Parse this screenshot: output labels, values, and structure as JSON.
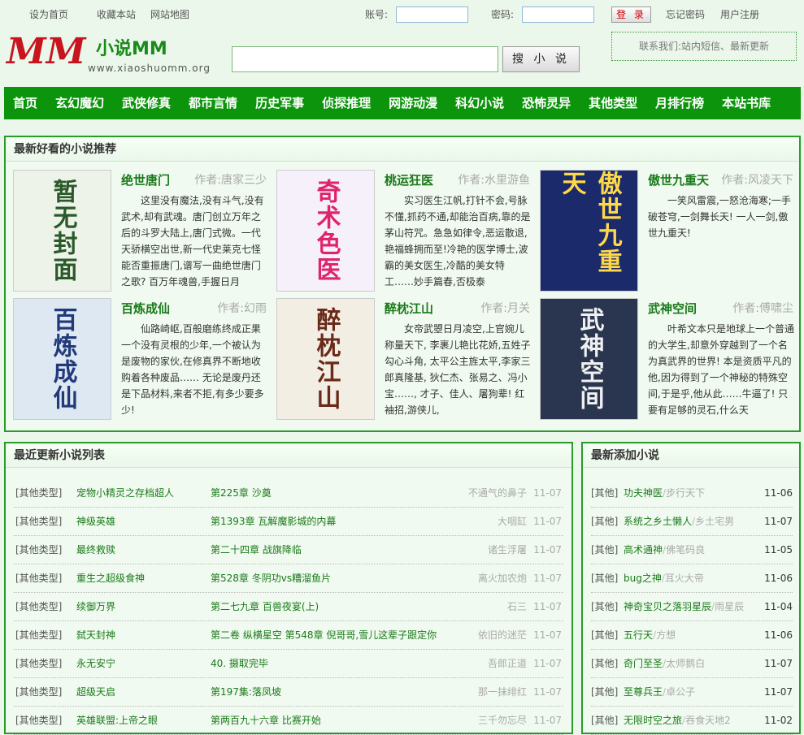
{
  "top_links": {
    "home": "设为首页",
    "fav": "收藏本站",
    "map": "网站地图"
  },
  "login": {
    "account_label": "账号:",
    "password_label": "密码:",
    "button": "登 录",
    "forgot": "忘记密码",
    "register": "用户注册"
  },
  "logo": {
    "mm": "MM",
    "cn": "小说MM",
    "url": "www.xiaoshuomm.org"
  },
  "search": {
    "button": "搜 小 说"
  },
  "contact": "联系我们:站内短信、最新更新",
  "nav": [
    "首页",
    "玄幻魔幻",
    "武侠修真",
    "都市言情",
    "历史军事",
    "侦探推理",
    "网游动漫",
    "科幻小说",
    "恐怖灵异",
    "其他类型",
    "月排行榜",
    "本站书库"
  ],
  "recommend": {
    "title": "最新好看的小说推荐",
    "books": [
      {
        "title": "绝世唐门",
        "author": "作者:唐家三少",
        "cover_text": "暂无封面",
        "desc": "这里没有魔法,没有斗气,没有武术,却有武魂。唐门创立万年之后的斗罗大陆上,唐门式微。一代天骄横空出世,新一代史莱克七怪能否重振唐门,谱写一曲绝世唐门之歌? 百万年魂兽,手握日月"
      },
      {
        "title": "桃运狂医",
        "author": "作者:水里游鱼",
        "cover_text": "奇术色医",
        "desc": "实习医生江帆,打针不会,号脉不懂,抓药不通,却能治百病,靠的是茅山符咒。急急如律令,恶运散退,艳福蜂拥而至!冷艳的医学博士,波霸的美女医生,冷酷的美女特工……妙手篇春,否极泰"
      },
      {
        "title": "傲世九重天",
        "author": "作者:风凌天下",
        "cover_text": "傲世九重天",
        "desc": "一笑风雷震,一怒沧海寒;一手破苍穹,一剑舞长天! 一人一剑,傲世九重天!"
      },
      {
        "title": "百炼成仙",
        "author": "作者:幻雨",
        "cover_text": "百炼成仙",
        "desc": "仙路崎岖,百般磨练终成正果一个没有灵根的少年,一个被认为是废物的家伙,在修真界不断地收购着各种废品…… 无论是废丹还是下品材料,来者不拒,有多少要多少!"
      },
      {
        "title": "醉枕江山",
        "author": "作者:月关",
        "cover_text": "醉枕江山",
        "desc": "女帝武曌日月凌空,上官婉儿称量天下, 李裹儿艳比花娇,五姓子勾心斗角, 太平公主旌太平,李家三郎真隆基, 狄仁杰、张易之、冯小宝……, 才子、佳人、屠狗辈! 红袖招,游侠儿,"
      },
      {
        "title": "武神空间",
        "author": "作者:傅啸尘",
        "cover_text": "武神空间",
        "desc": "叶希文本只是地球上一个普通的大学生,却意外穿越到了一个名为真武界的世界! 本是资质平凡的他,因为得到了一个神秘的特殊空间,于是乎,他从此……牛逼了! 只要有足够的灵石,什么天"
      }
    ]
  },
  "updates": {
    "title": "最近更新小说列表",
    "rows": [
      {
        "cat": "[其他类型]",
        "name": "宠物小精灵之存档超人",
        "chapter": "第225章 沙奠",
        "author": "不通气的鼻子",
        "date": "11-07"
      },
      {
        "cat": "[其他类型]",
        "name": "神级英雄",
        "chapter": "第1393章 瓦解魔影城的内幕",
        "author": "大咽缸",
        "date": "11-07"
      },
      {
        "cat": "[其他类型]",
        "name": "最终救赎",
        "chapter": "第二十四章 战旗降临",
        "author": "诸生浮屠",
        "date": "11-07"
      },
      {
        "cat": "[其他类型]",
        "name": "重生之超级食神",
        "chapter": "第528章 冬阴功vs糟溜鱼片",
        "author": "离火加农炮",
        "date": "11-07"
      },
      {
        "cat": "[其他类型]",
        "name": "续御万界",
        "chapter": "第二七九章 百兽夜宴(上)",
        "author": "石三",
        "date": "11-07"
      },
      {
        "cat": "[其他类型]",
        "name": "弑天封神",
        "chapter": "第二卷 纵横星空 第548章 倪哥哥,雪儿这辈子跟定你",
        "author": "依旧的迷茫",
        "date": "11-07"
      },
      {
        "cat": "[其他类型]",
        "name": "永无安宁",
        "chapter": "40. 摄取完毕",
        "author": "吾郎正道",
        "date": "11-07"
      },
      {
        "cat": "[其他类型]",
        "name": "超级天启",
        "chapter": "第197集:落凤坡",
        "author": "那一抹绯红",
        "date": "11-07"
      },
      {
        "cat": "[其他类型]",
        "name": "英雄联盟:上帝之眼",
        "chapter": "第两百九十六章 比赛开始",
        "author": "三千勿忘尽",
        "date": "11-07"
      }
    ]
  },
  "newest": {
    "title": "最新添加小说",
    "rows": [
      {
        "cat": "[其他]",
        "name": "功夫神医",
        "author": "步行天下",
        "date": "11-06"
      },
      {
        "cat": "[其他]",
        "name": "系统之乡土懒人",
        "author": "乡土宅男",
        "date": "11-07"
      },
      {
        "cat": "[其他]",
        "name": "高术通神",
        "author": "佛笔码良",
        "date": "11-05"
      },
      {
        "cat": "[其他]",
        "name": "bug之神",
        "author": "耳火大帝",
        "date": "11-06"
      },
      {
        "cat": "[其他]",
        "name": "神奇宝贝之落羽星辰",
        "author": "雨星辰",
        "date": "11-04"
      },
      {
        "cat": "[其他]",
        "name": "五行天",
        "author": "方想",
        "date": "11-06"
      },
      {
        "cat": "[其他]",
        "name": "奇门至圣",
        "author": "太师鹅白",
        "date": "11-07"
      },
      {
        "cat": "[其他]",
        "name": "至尊兵王",
        "author": "卓公子",
        "date": "11-07"
      },
      {
        "cat": "[其他]",
        "name": "无限时空之旅",
        "author": "吞食天地2",
        "date": "11-02"
      }
    ]
  }
}
